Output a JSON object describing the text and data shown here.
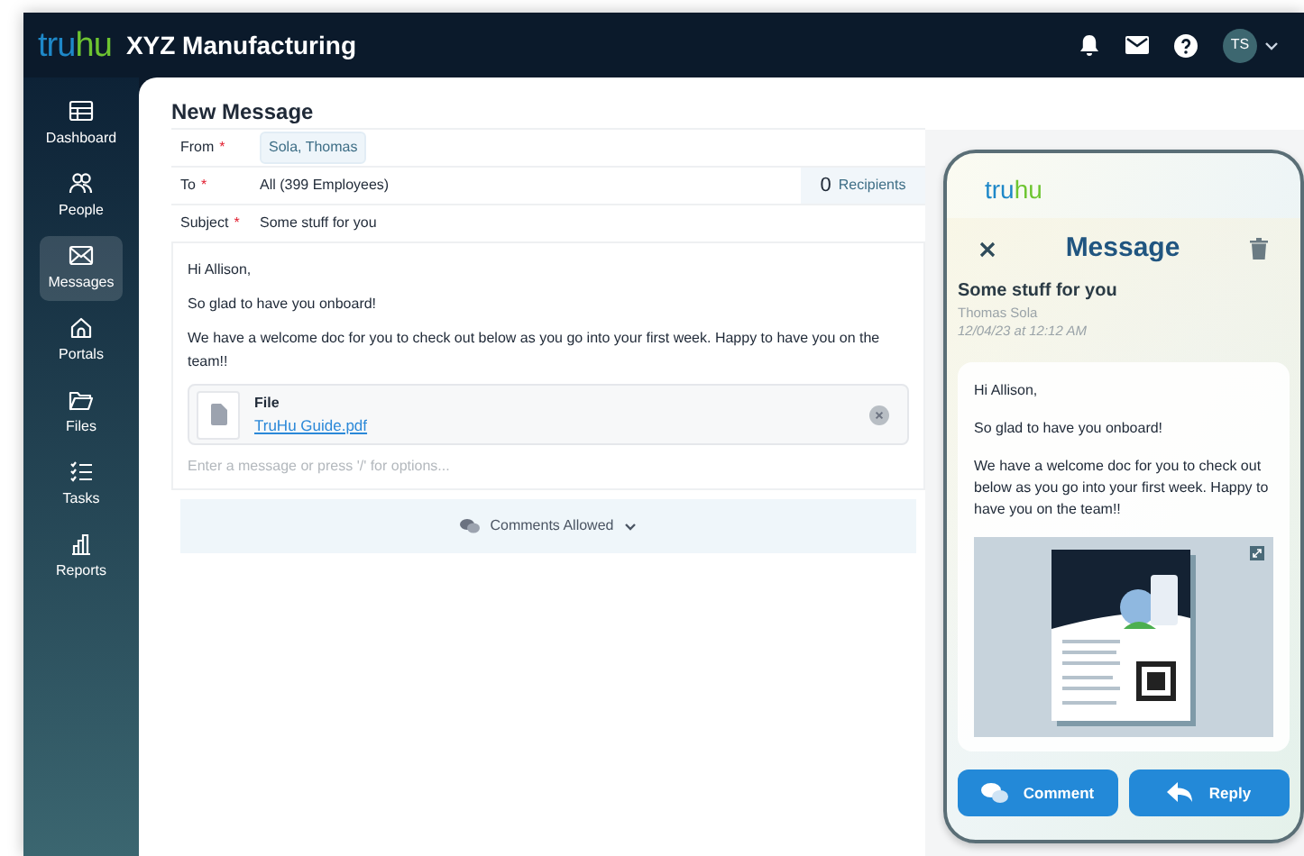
{
  "header": {
    "logo": [
      "tru",
      "hu"
    ],
    "company": "XYZ Manufacturing",
    "avatar": "TS"
  },
  "sidebar": {
    "items": [
      {
        "label": "Dashboard",
        "kind": "dashboard",
        "selected": false
      },
      {
        "label": "People",
        "kind": "people",
        "selected": false
      },
      {
        "label": "Messages",
        "kind": "messages",
        "selected": true
      },
      {
        "label": "Portals",
        "kind": "portals",
        "selected": false
      },
      {
        "label": "Files",
        "kind": "files",
        "selected": false
      },
      {
        "label": "Tasks",
        "kind": "tasks",
        "selected": false
      },
      {
        "label": "Reports",
        "kind": "reports",
        "selected": false
      }
    ]
  },
  "compose": {
    "title": "New Message",
    "fields": [
      {
        "label": "From",
        "required_mark": "*",
        "value": "Sola, Thomas",
        "kind": "chip"
      },
      {
        "label": "To",
        "required_mark": "*",
        "value": "All (399 Employees)",
        "kind": "recipients",
        "count": "0",
        "count_label": "Recipients"
      },
      {
        "label": "Subject",
        "required_mark": "*",
        "value": "Some stuff for you",
        "kind": "text"
      }
    ],
    "body": [
      "Hi Allison,",
      "So glad to have you onboard!",
      "We have a welcome doc for you to check out below as you go into your first week. Happy to have you on the team!!"
    ],
    "attachment": {
      "label": "File",
      "name": "TruHu Guide.pdf"
    },
    "placeholder": "Enter a message or press '/' for options...",
    "comments": "Comments Allowed"
  },
  "preview": {
    "logo": [
      "tru",
      "hu"
    ],
    "title": "Message",
    "subject": "Some stuff for you",
    "sender": "Thomas Sola",
    "date": "12/04/23 at 12:12 AM",
    "body": [
      "Hi Allison,",
      "So glad to have you onboard!",
      "We have a welcome doc for you to check out below as you go into your first week. Happy to have you on the team!!"
    ],
    "buttons": [
      {
        "label": "Comment",
        "kind": "comment"
      },
      {
        "label": "Reply",
        "kind": "reply"
      }
    ]
  }
}
